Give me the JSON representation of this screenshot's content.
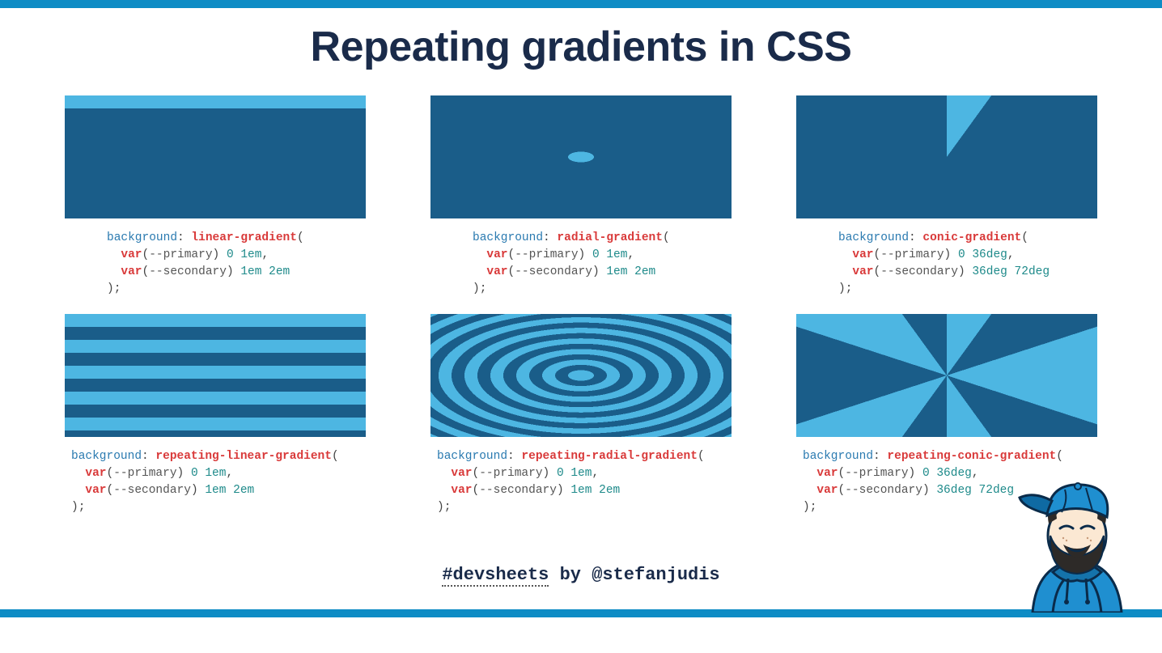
{
  "title": "Repeating gradients in CSS",
  "footer": {
    "hashtag": "#devsheets",
    "by": " by ",
    "handle": "@stefanjudis"
  },
  "code": {
    "prop": "background",
    "kw_var": "var",
    "var_primary": "--primary",
    "var_secondary": "--secondary",
    "stop_0_1em": "0 1em",
    "stop_1em_2em": "1em 2em",
    "stop_0_36deg": "0 36deg",
    "stop_36_72deg": "36deg 72deg"
  },
  "fns": {
    "linear": "linear-gradient",
    "radial": "radial-gradient",
    "conic": "conic-gradient",
    "rep_linear": "repeating-linear-gradient",
    "rep_radial": "repeating-radial-gradient",
    "rep_conic": "repeating-conic-gradient"
  }
}
